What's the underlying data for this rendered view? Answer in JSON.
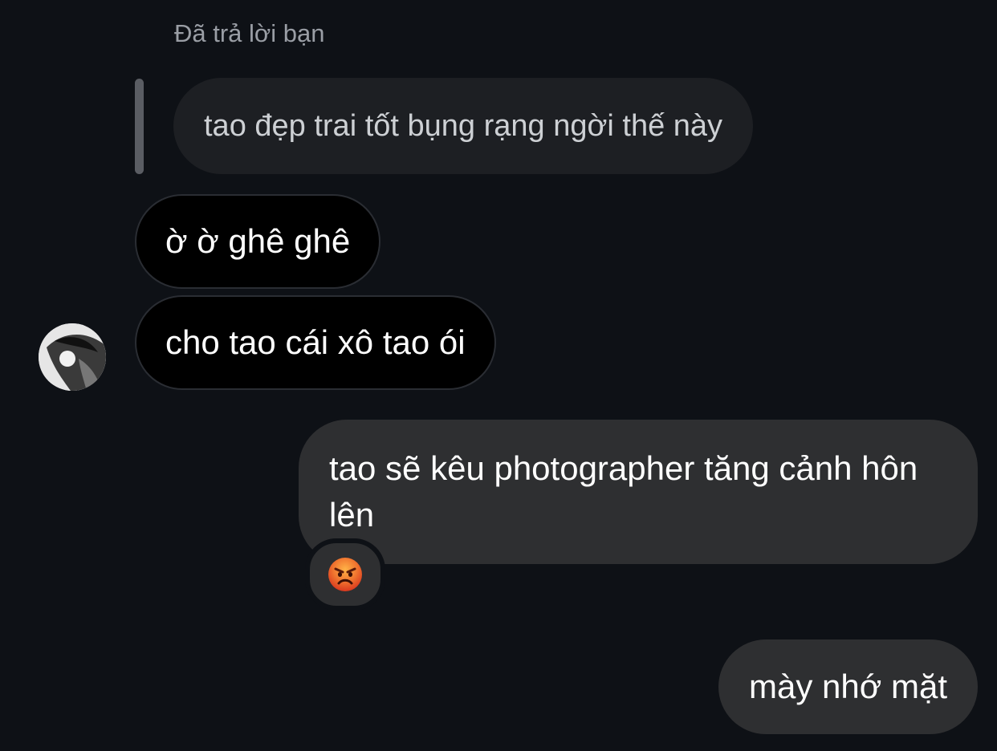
{
  "reply": {
    "label": "Đã trả lời bạn",
    "quoted_text": "tao đẹp trai tốt bụng rạng ngời thế này"
  },
  "messages": [
    {
      "direction": "received",
      "text": "ờ ờ ghê ghê"
    },
    {
      "direction": "received",
      "text": "cho tao cái xô tao ói"
    },
    {
      "direction": "sent",
      "text": "tao sẽ kêu photographer tăng cảnh hôn lên",
      "reaction": "angry-face-emoji"
    },
    {
      "direction": "sent",
      "text": "mày nhớ mặt"
    }
  ],
  "colors": {
    "background": "#0e1116",
    "received_bubble": "#000000",
    "sent_bubble": "#2e2f31",
    "reaction_face": "#e8542a"
  }
}
